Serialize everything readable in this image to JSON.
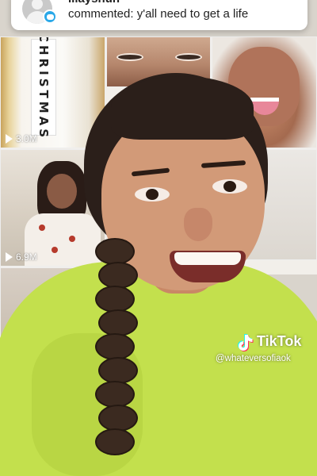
{
  "notification": {
    "username": "lilayshun",
    "comment": "commented: y'all need to get a life"
  },
  "grid": {
    "tiles": [
      {
        "board_text": "CHRISTMAS",
        "views": "3.0M"
      },
      {
        "views": "6.9M"
      }
    ]
  },
  "watermark": {
    "brand": "TikTok",
    "handle": "@whateversofiaok"
  },
  "icons": {
    "avatar": "user-avatar-icon",
    "comment_badge": "comment-bubble-icon",
    "play": "play-icon",
    "tiktok": "tiktok-logo-icon"
  },
  "colors": {
    "shirt": "#c3e04d",
    "badge": "#2aa8e8",
    "notification_bg": "#ffffff"
  }
}
